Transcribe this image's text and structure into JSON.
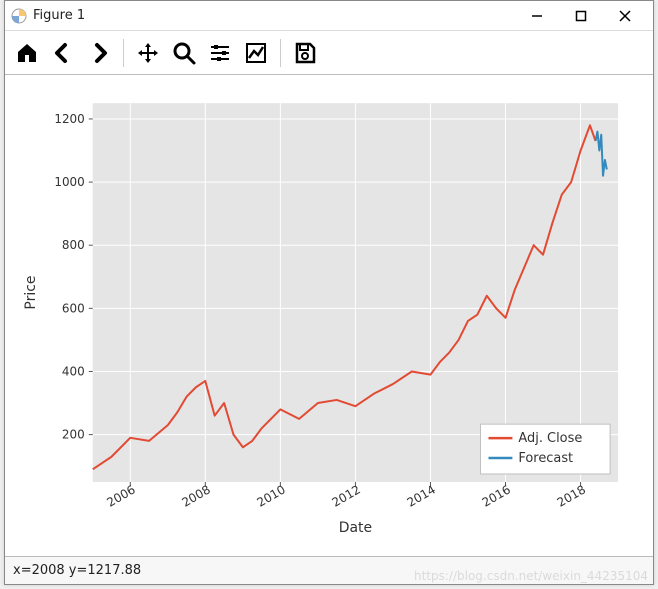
{
  "window": {
    "title": "Figure 1",
    "controls": {
      "minimize": "min",
      "maximize": "max",
      "close": "close"
    }
  },
  "toolbar": {
    "home": "home-icon",
    "back": "back-icon",
    "forward": "forward-icon",
    "pan": "pan-icon",
    "zoom": "zoom-icon",
    "subplots": "subplots-icon",
    "axes": "axes-icon",
    "save": "save-icon"
  },
  "statusbar": {
    "coords": "x=2008 y=1217.88"
  },
  "watermark": "https://blog.csdn.net/weixin_44235104",
  "chart_data": {
    "type": "line",
    "xlabel": "Date",
    "ylabel": "Price",
    "xlim": [
      2005,
      2019
    ],
    "ylim": [
      50,
      1250
    ],
    "xticks": [
      2006,
      2008,
      2010,
      2012,
      2014,
      2016,
      2018
    ],
    "yticks": [
      200,
      400,
      600,
      800,
      1000,
      1200
    ],
    "legend_position": "lower right",
    "series": [
      {
        "name": "Adj. Close",
        "color": "#e24a33",
        "x": [
          2005.0,
          2005.5,
          2006.0,
          2006.5,
          2007.0,
          2007.25,
          2007.5,
          2007.75,
          2008.0,
          2008.25,
          2008.5,
          2008.75,
          2009.0,
          2009.25,
          2009.5,
          2010.0,
          2010.5,
          2011.0,
          2011.5,
          2012.0,
          2012.5,
          2013.0,
          2013.5,
          2014.0,
          2014.25,
          2014.5,
          2014.75,
          2015.0,
          2015.25,
          2015.5,
          2015.75,
          2016.0,
          2016.25,
          2016.5,
          2016.75,
          2017.0,
          2017.25,
          2017.5,
          2017.75,
          2018.0,
          2018.25,
          2018.4
        ],
        "y": [
          90,
          130,
          190,
          180,
          230,
          270,
          320,
          350,
          370,
          260,
          300,
          200,
          160,
          180,
          220,
          280,
          250,
          300,
          310,
          290,
          330,
          360,
          400,
          390,
          430,
          460,
          500,
          560,
          580,
          640,
          600,
          570,
          660,
          730,
          800,
          770,
          870,
          960,
          1000,
          1100,
          1180,
          1130
        ]
      },
      {
        "name": "Forecast",
        "color": "#348abd",
        "x": [
          2018.4,
          2018.45,
          2018.5,
          2018.55,
          2018.6,
          2018.65,
          2018.7
        ],
        "y": [
          1130,
          1160,
          1100,
          1150,
          1020,
          1070,
          1040
        ]
      }
    ]
  }
}
